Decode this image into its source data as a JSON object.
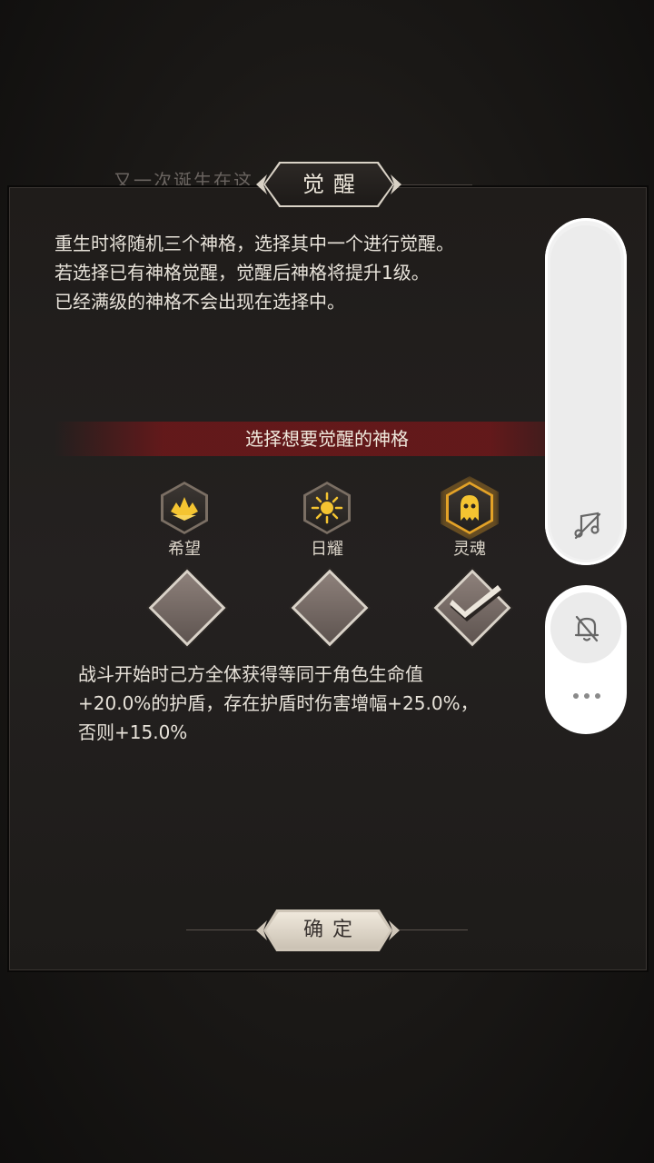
{
  "background": {
    "text": "又一次诞生在这"
  },
  "dialog": {
    "title": "觉醒",
    "description": [
      "重生时将随机三个神格，选择其中一个进行觉醒。",
      "若选择已有神格觉醒，觉醒后神格将提升1级。",
      "已经满级的神格不会出现在选择中。"
    ],
    "section_title": "选择想要觉醒的神格",
    "divinities": [
      {
        "label": "希望",
        "icon": "hope-crown-icon",
        "selected": false
      },
      {
        "label": "日耀",
        "icon": "sun-icon",
        "selected": false
      },
      {
        "label": "灵魂",
        "icon": "ghost-soul-icon",
        "selected": true
      }
    ],
    "effect": [
      "战斗开始时己方全体获得等同于角色生命值",
      "+20.0%的护盾，存在护盾时伤害增幅+25.0%，",
      "否则+15.0%"
    ],
    "confirm_label": "确定"
  },
  "side_panel": {
    "icons": [
      "music-off-icon",
      "bell-off-icon",
      "more-dots-icon"
    ]
  },
  "colors": {
    "accent_gold": "#e3a227",
    "section_red": "#6e181a",
    "text_light": "#e8e3da"
  }
}
